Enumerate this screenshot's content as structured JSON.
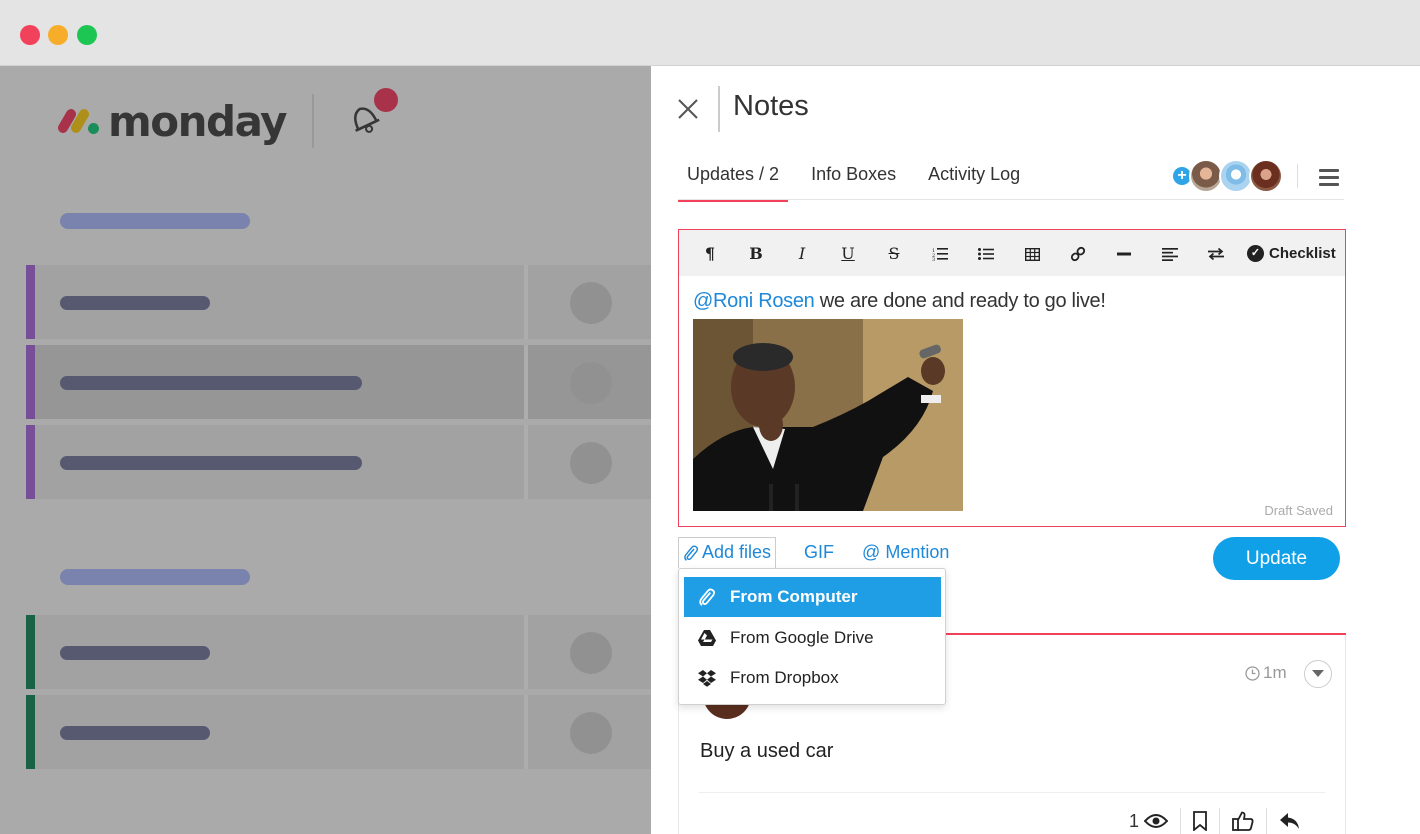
{
  "app": {
    "logo_text": "monday"
  },
  "panel": {
    "title": "Notes",
    "tabs": [
      {
        "label": "Updates / 2"
      },
      {
        "label": "Info Boxes"
      },
      {
        "label": "Activity Log"
      }
    ]
  },
  "editor": {
    "mention": "@Roni Rosen",
    "body": " we are done and ready to go live!",
    "draft_status": "Draft Saved",
    "checklist_label": "Checklist"
  },
  "actions": {
    "add_files": "Add files",
    "gif": "GIF",
    "mention": "@ Mention",
    "update_button": "Update"
  },
  "file_menu": {
    "items": [
      {
        "label": "From Computer",
        "icon": "paperclip-icon",
        "selected": true
      },
      {
        "label": "From Google Drive",
        "icon": "google-drive-icon",
        "selected": false
      },
      {
        "label": "From Dropbox",
        "icon": "dropbox-icon",
        "selected": false
      }
    ]
  },
  "post": {
    "time": "1m",
    "text": "Buy a used car",
    "seen_count": "1"
  },
  "colors": {
    "accent_red": "#f2415a",
    "link_blue": "#1e88d9",
    "button_blue": "#0fa0e8"
  }
}
